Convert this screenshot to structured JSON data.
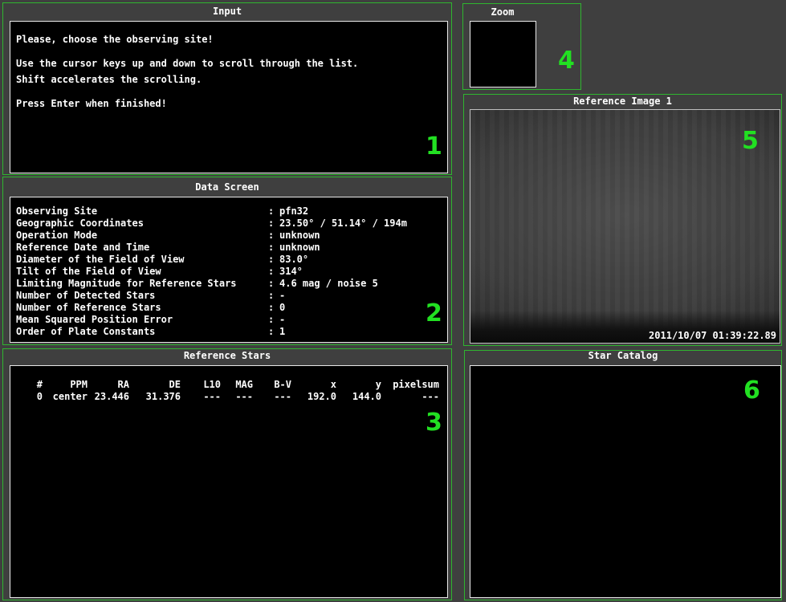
{
  "input": {
    "title": "Input",
    "lines": [
      "Please, choose the observing site!",
      "Use the cursor keys up and down to scroll through the list.",
      "Shift accelerates the scrolling.",
      "Press Enter when finished!"
    ],
    "marker": "1"
  },
  "zoom": {
    "title": "Zoom",
    "marker": "4"
  },
  "data_screen": {
    "title": "Data Screen",
    "marker": "2",
    "rows": [
      {
        "label": "Observing Site",
        "value": "pfn32"
      },
      {
        "label": "Geographic Coordinates",
        "value": "23.50° / 51.14° / 194m"
      },
      {
        "label": "Operation Mode",
        "value": "unknown"
      },
      {
        "label": "Reference Date and Time",
        "value": "unknown"
      },
      {
        "label": "Diameter of the Field of View",
        "value": "83.0°"
      },
      {
        "label": "Tilt of the Field of View",
        "value": "314°"
      },
      {
        "label": "Limiting Magnitude for Reference Stars",
        "value": "4.6 mag / noise 5"
      },
      {
        "label": "Number of Detected Stars",
        "value": "-"
      },
      {
        "label": "Number of Reference Stars",
        "value": "0"
      },
      {
        "label": "Mean Squared Position Error",
        "value": "-"
      },
      {
        "label": "Order of Plate Constants",
        "value": "1"
      }
    ]
  },
  "reference_image": {
    "title": "Reference Image 1",
    "timestamp": "2011/10/07 01:39:22.89",
    "marker": "5"
  },
  "reference_stars": {
    "title": "Reference Stars",
    "marker": "3",
    "columns": [
      "#",
      "PPM",
      "RA",
      "DE",
      "L10",
      "MAG",
      "B-V",
      "x",
      "y",
      "pixelsum"
    ],
    "rows": [
      [
        "0",
        "center",
        "23.446",
        "31.376",
        "---",
        "---",
        "---",
        "192.0",
        "144.0",
        "---"
      ]
    ]
  },
  "star_catalog": {
    "title": "Star Catalog",
    "marker": "6"
  },
  "colors": {
    "frame": "#2fb52f",
    "marker": "#22e022",
    "screen": "#000000",
    "background": "#3f3f3f"
  }
}
